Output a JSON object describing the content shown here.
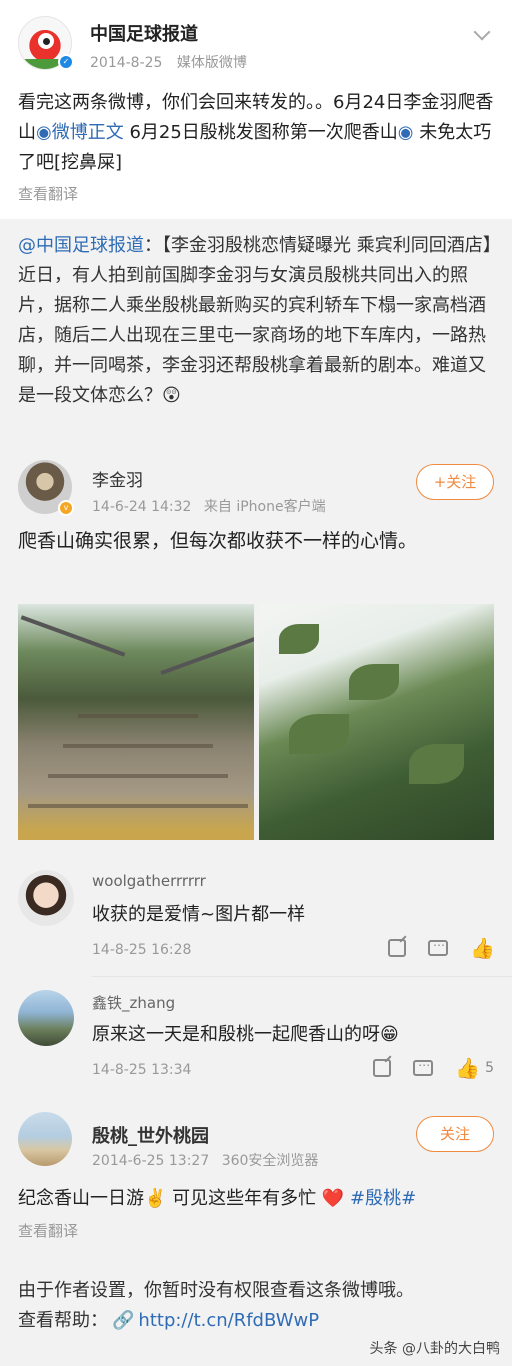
{
  "post": {
    "author": "中国足球报道",
    "date": "2014-8-25",
    "source": "媒体版微博",
    "text_a": "看完这两条微博，你们会回来转发的。。6月24日李金羽爬香山",
    "link1": "微博正文",
    "text_b": " 6月25日殷桃发图称第一次爬香山",
    "text_c": " 未免太巧了吧[挖鼻屎]",
    "translate": "查看翻译"
  },
  "quote": {
    "mention": "@中国足球报道",
    "text": "：【李金羽殷桃恋情疑曝光 乘宾利同回酒店】近日，有人拍到前国脚李金羽与女演员殷桃共同出入的照片，据称二人乘坐殷桃最新购买的宾利轿车下榻一家高档酒店，随后二人出现在三里屯一家商场的地下车库内，一路热聊，并一同喝茶，李金羽还帮殷桃拿着最新的剧本。难道又是一段文体恋么？",
    "emoji": "😲"
  },
  "sub1": {
    "name": "李金羽",
    "date": "14-6-24 14:32",
    "source": "来自 iPhone客户端",
    "follow": "+关注",
    "text": "爬香山确实很累，但每次都收获不一样的心情。"
  },
  "comments": [
    {
      "name": "woolgatherrrrrr",
      "text": "收获的是爱情~图片都一样",
      "time": "14-8-25 16:28",
      "likes": ""
    },
    {
      "name": "鑫铁_zhang",
      "text": "原来这一天是和殷桃一起爬香山的呀😁",
      "time": "14-8-25 13:34",
      "likes": "5"
    }
  ],
  "sub2": {
    "name": "殷桃_世外桃园",
    "date": "2014-6-25 13:27",
    "source": "360安全浏览器",
    "follow": "关注",
    "text": "纪念香山一日游✌️ 可见这些年有多忙 ❤️ ",
    "tag": "#殷桃#",
    "translate": "查看翻译"
  },
  "notice": {
    "line1": "由于作者设置，你暂时没有权限查看这条微博哦。",
    "help": "查看帮助：",
    "link": "http://t.cn/RfdBWwP"
  },
  "watermark": "头条 @八卦的大白鸭",
  "colors": {
    "link": "#2f6cb5",
    "follow": "#f08a40",
    "quote_bg": "#f2f2f2"
  }
}
